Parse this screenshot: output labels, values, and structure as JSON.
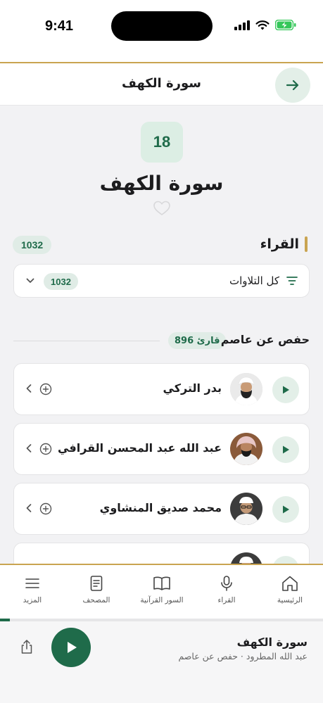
{
  "status_bar": {
    "time": "9:41"
  },
  "header": {
    "title": "سورة الكهف"
  },
  "surah": {
    "number": "18",
    "name": "سورة الكهف"
  },
  "reciters_section": {
    "title": "القراء",
    "count": "1032",
    "filter": {
      "label": "كل التلاوات",
      "count": "1032"
    }
  },
  "riwaya": {
    "title": "حفص عن عاصم",
    "badge": "896 قارئ"
  },
  "reciters": [
    {
      "name": "بدر التركي",
      "avatar_color": "#eaeaea",
      "cap_color": "#ffffff"
    },
    {
      "name": "عبد الله عبد المحسن القرافي",
      "avatar_color": "#8a5a3a",
      "cap_color": "#e8c6c6"
    },
    {
      "name": "محمد صديق المنشاوي",
      "avatar_color": "#3c3c3c",
      "cap_color": "#ffffff"
    },
    {
      "name": "",
      "avatar_color": "#3c3c3c",
      "cap_color": "#ffffff"
    }
  ],
  "tabs": [
    {
      "label": "الرئيسية",
      "icon": "home-icon"
    },
    {
      "label": "القراء",
      "icon": "microphone-icon"
    },
    {
      "label": "السور القرآنية",
      "icon": "open-book-icon"
    },
    {
      "label": "المصحف",
      "icon": "mushaf-icon"
    },
    {
      "label": "المزيد",
      "icon": "menu-icon"
    }
  ],
  "player": {
    "title": "سورة الكهف",
    "subtitle": "عبد الله المطرود · حفص عن عاصم",
    "progress": 0.03
  },
  "colors": {
    "accent": "#1f6b4a",
    "gold": "#c9a451",
    "badge_bg": "#e0ece6"
  }
}
